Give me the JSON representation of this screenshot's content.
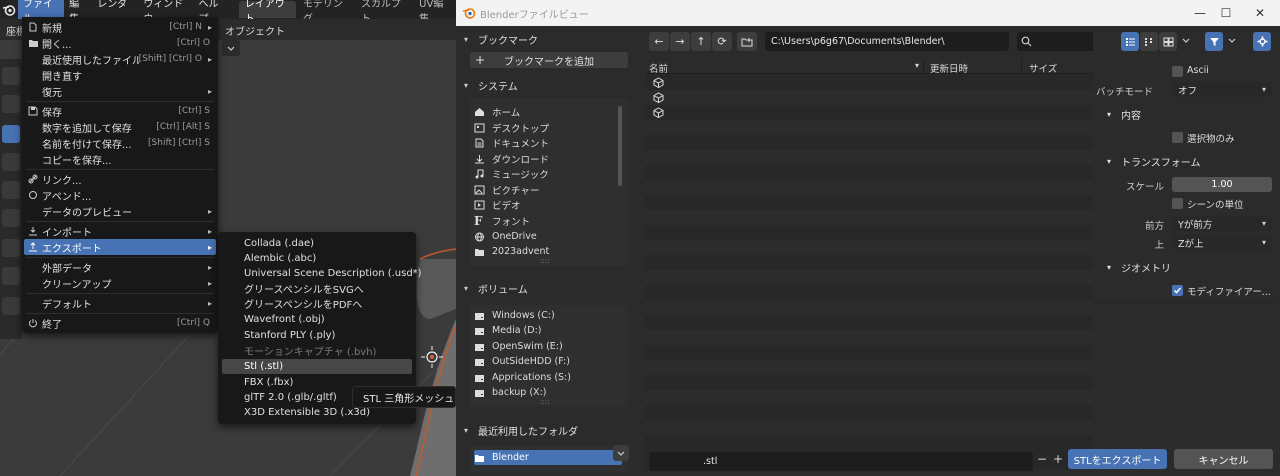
{
  "blender": {
    "menubar": [
      "ファイル",
      "編集",
      "レンダー",
      "ウィンドウ",
      "ヘルプ"
    ],
    "workspaces": [
      "レイアウト",
      "モデリング",
      "スカルプト",
      "UV編集"
    ],
    "left_label": "座標",
    "viewport_label": "オブジェクト"
  },
  "file_menu": {
    "items": [
      {
        "label": "新規",
        "shortcut": "[Ctrl] N"
      },
      {
        "label": "開く...",
        "shortcut": "[Ctrl] O"
      },
      {
        "label": "最近使用したファイル",
        "shortcut": "[Shift] [Ctrl] O"
      },
      {
        "label": "開き直す",
        "shortcut": ""
      },
      {
        "label": "復元",
        "shortcut": ""
      },
      {
        "label": "保存",
        "shortcut": "[Ctrl] S"
      },
      {
        "label": "数字を追加して保存",
        "shortcut": "[Ctrl] [Alt] S"
      },
      {
        "label": "名前を付けて保存...",
        "shortcut": "[Shift] [Ctrl] S"
      },
      {
        "label": "コピーを保存...",
        "shortcut": ""
      },
      {
        "label": "リンク...",
        "shortcut": ""
      },
      {
        "label": "アペンド...",
        "shortcut": ""
      },
      {
        "label": "データのプレビュー",
        "shortcut": ""
      },
      {
        "label": "インポート",
        "shortcut": ""
      },
      {
        "label": "エクスポート",
        "shortcut": ""
      },
      {
        "label": "外部データ",
        "shortcut": ""
      },
      {
        "label": "クリーンアップ",
        "shortcut": ""
      },
      {
        "label": "デフォルト",
        "shortcut": ""
      },
      {
        "label": "終了",
        "shortcut": "[Ctrl] Q"
      }
    ]
  },
  "export_menu": {
    "items": [
      "Collada (.dae)",
      "Alembic (.abc)",
      "Universal Scene Description (.usd*)",
      "グリースペンシルをSVGへ",
      "グリースペンシルをPDFへ",
      "Wavefront (.obj)",
      "Stanford PLY (.ply)",
      "モーションキャプチャ (.bvh)",
      "Stl (.stl)",
      "FBX (.fbx)",
      "glTF 2.0 (.glb/.gltf)",
      "X3D Extensible 3D (.x3d)"
    ],
    "tooltip": "STL 三角形メッシュデー"
  },
  "file_browser": {
    "title": "Blenderファイルビュー",
    "bookmarks": {
      "header": "ブックマーク",
      "add_button": "ブックマークを追加"
    },
    "system": {
      "header": "システム",
      "items": [
        "ホーム",
        "デスクトップ",
        "ドキュメント",
        "ダウンロード",
        "ミュージック",
        "ピクチャー",
        "ビデオ",
        "フォント",
        "OneDrive",
        "2023advent"
      ]
    },
    "volumes": {
      "header": "ボリューム",
      "items": [
        "Windows (C:)",
        "Media (D:)",
        "OpenSwim (E:)",
        "OutSideHDD (F:)",
        "Apprications (S:)",
        "backup (X:)"
      ]
    },
    "recent": {
      "header": "最近利用したフォルダ",
      "items": [
        "Blender"
      ]
    },
    "path": "C:\\Users\\p6g67\\Documents\\Blender\\",
    "columns": [
      "名前",
      "更新日時",
      "サイズ"
    ],
    "filename": ".stl",
    "export_button": "STLをエクスポート",
    "cancel_button": "キャンセル",
    "accent": "#4772b3"
  },
  "options": {
    "ascii_label": "Ascii",
    "batch_label": "バッチモード",
    "batch_value": "オフ",
    "include_header": "内容",
    "selected_only": "選択物のみ",
    "transform_header": "トランスフォーム",
    "scale_label": "スケール",
    "scale_value": "1.00",
    "scene_unit": "シーンの単位",
    "forward_label": "前方",
    "forward_value": "Yが前方",
    "up_label": "上",
    "up_value": "Zが上",
    "geometry_header": "ジオメトリ",
    "modifiers_label": "モディファイアー..."
  }
}
